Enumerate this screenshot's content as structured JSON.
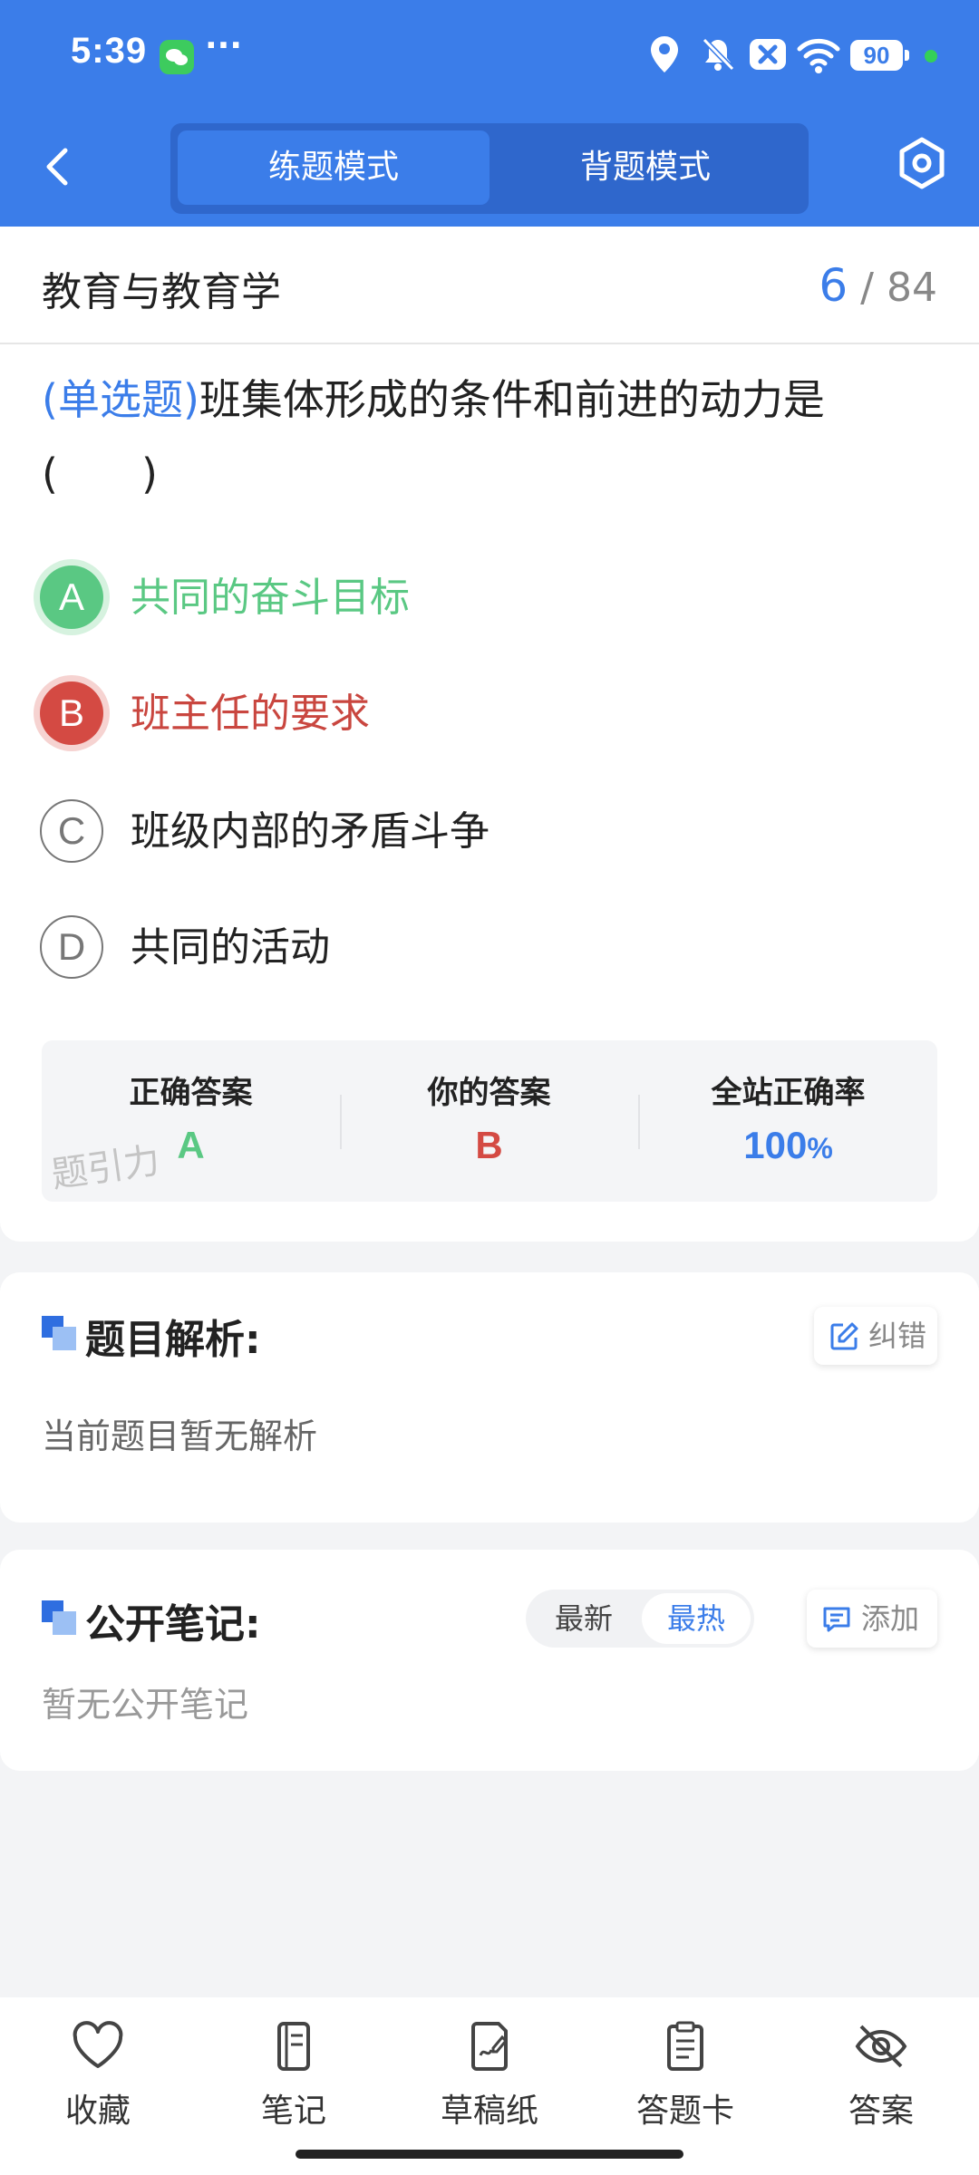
{
  "status_bar": {
    "time": "5:39",
    "dots": "···",
    "battery": "90"
  },
  "nav": {
    "mode_practice": "练题模式",
    "mode_memorize": "背题模式"
  },
  "header": {
    "subject": "教育与教育学",
    "current": "6",
    "sep": "/",
    "total": "84"
  },
  "question": {
    "type": "(单选题)",
    "text": "班集体形成的条件和前进的动力是(　　)"
  },
  "options": [
    {
      "letter": "A",
      "text": "共同的奋斗目标",
      "state": "correct"
    },
    {
      "letter": "B",
      "text": "班主任的要求",
      "state": "wrong"
    },
    {
      "letter": "C",
      "text": "班级内部的矛盾斗争",
      "state": "normal"
    },
    {
      "letter": "D",
      "text": "共同的活动",
      "state": "normal"
    }
  ],
  "stats": {
    "correct_label": "正确答案",
    "correct_value": "A",
    "yours_label": "你的答案",
    "yours_value": "B",
    "rate_label": "全站正确率",
    "rate_value": "100",
    "rate_unit": "%",
    "watermark": "题引力"
  },
  "analysis": {
    "title": "题目解析:",
    "correction_label": "纠错",
    "empty_text": "当前题目暂无解析"
  },
  "notes": {
    "title": "公开笔记:",
    "sort_latest": "最新",
    "sort_hottest": "最热",
    "add_label": "添加",
    "empty_text": "暂无公开笔记"
  },
  "tabbar": {
    "favorite": "收藏",
    "notes": "笔记",
    "scratch": "草稿纸",
    "answer_sheet": "答题卡",
    "answer": "答案"
  },
  "colors": {
    "primary": "#3b7de9",
    "correct": "#5ac883",
    "wrong": "#d44a43"
  }
}
